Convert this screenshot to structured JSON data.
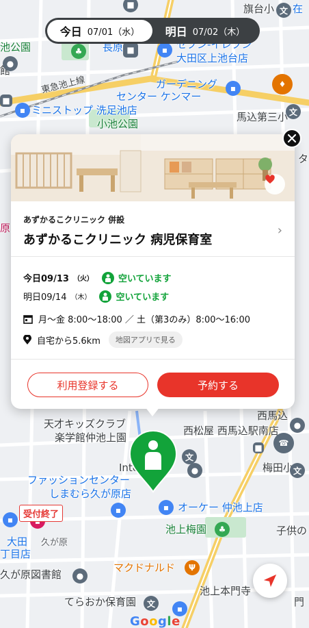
{
  "day_toggle": {
    "today": {
      "name": "今日",
      "date": "07/01（水）"
    },
    "tomorrow": {
      "name": "明日",
      "date": "07/02（木）"
    }
  },
  "map_labels": {
    "hatadai": "旗台小",
    "zai": "在",
    "ike_park": "池公園",
    "naga": "長原",
    "seven": "セブン-イレブン",
    "seven_branch": "大田区上池台店",
    "tokyu_line": "東急池上線",
    "gardening_1": "ガーデニング",
    "gardening_2": "センター ケンマー",
    "ministop": "ミニストップ 洗足池店",
    "koike_park": "小池公園",
    "magome": "馬込第三小",
    "kan": "館",
    "ta": "タ",
    "hara": "原",
    "nishi": "西馬込",
    "tensai_1": "天才キッズクラブ",
    "tensai_2": "楽学館仲池上園",
    "nishimatsuya": "西松屋 西馬込駅南店",
    "international": "Internat",
    "umeda": "梅田小",
    "shimamura_1": "ファッションセンター",
    "shimamura_2": "しまむら久が原店",
    "okay": "オーケー 仲池上店",
    "ikegami_ume": "池上梅園",
    "kodomo": "子供の",
    "ota": "大田",
    "kugahara": "久が原",
    "ota_shop": "丁目店",
    "library": "久が原図書館",
    "mcd": "マクドナルド",
    "honmon": "池上本門寺",
    "mon": "門",
    "teraoka": "てらおか保育園"
  },
  "card": {
    "subtitle": "あずかるこクリニック 併設",
    "title": "あずかるこクリニック 病児保育室",
    "availability": [
      {
        "day": "今日09/13",
        "weekday": "（火）",
        "status": "空いています"
      },
      {
        "day": "明日09/14",
        "weekday": "（木）",
        "status": "空いています"
      }
    ],
    "hours": "月〜金 8:00〜18:00 ／ 土（第3のみ）8:00〜16:00",
    "distance": "自宅から5.6km",
    "map_app_label": "地図アプリで見る",
    "register_label": "利用登録する",
    "reserve_label": "予約する"
  },
  "badge_closed": "受付終了",
  "google_logo": "Google",
  "colors": {
    "accent_red": "#e8342a",
    "available_green": "#12a33a",
    "pin_green": "#12a33a",
    "toggle_dark": "#3c4043"
  },
  "icons": {
    "close": "close-icon",
    "heart": "heart-icon",
    "chevron": "chevron-right-icon",
    "calendar": "calendar-icon",
    "location": "location-pin-icon",
    "navigate": "navigation-arrow-icon",
    "nursery_pin": "nursery-pin-icon"
  }
}
